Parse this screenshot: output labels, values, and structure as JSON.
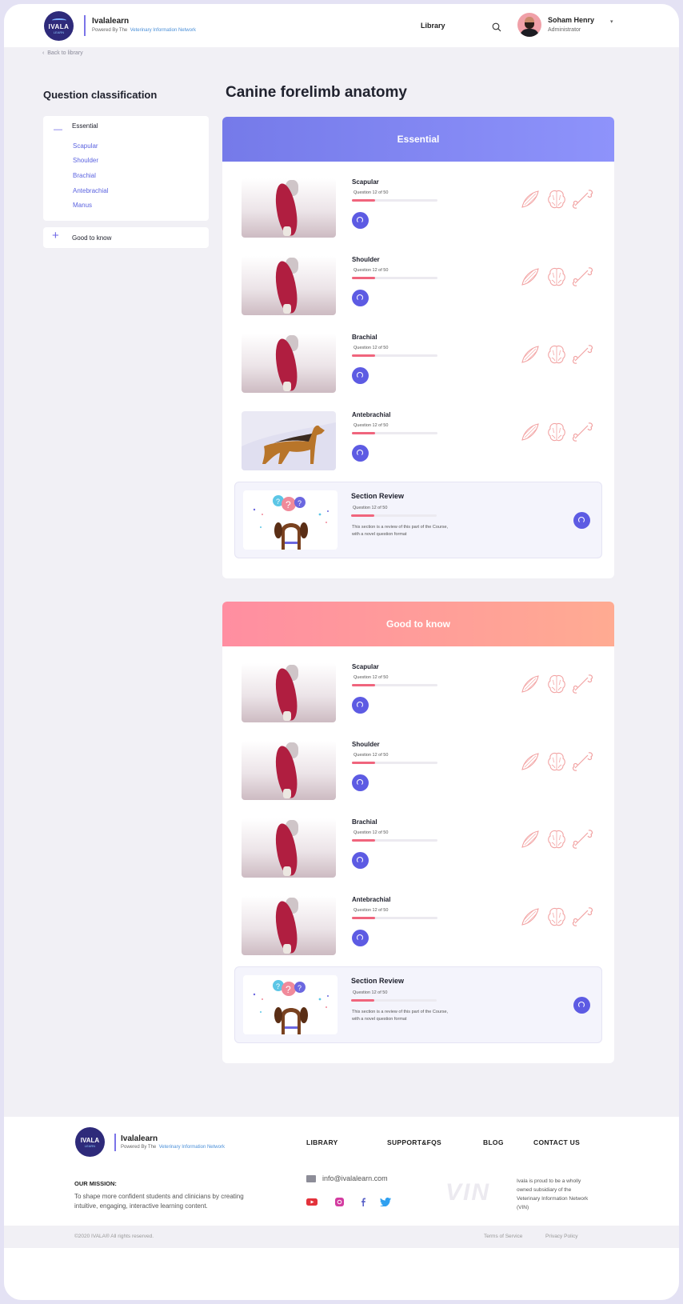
{
  "header": {
    "logo_text": "IVALA",
    "logo_sub": "LEARN",
    "brand_name": "Ivalalearn",
    "powered_by": "Powered By The",
    "powered_link": "Veterinary Information Network",
    "nav_library": "Library",
    "user_name": "Soham Henry",
    "user_role": "Administrator"
  },
  "back_link": "Back to library",
  "sidebar": {
    "title": "Question classification",
    "sections": [
      {
        "label": "Essential",
        "expanded": true,
        "items": [
          "Scapular",
          "Shoulder",
          "Brachial",
          "Antebrachial",
          "Manus"
        ]
      },
      {
        "label": "Good to know",
        "expanded": false
      }
    ]
  },
  "main": {
    "title": "Canine forelimb anatomy",
    "sections": [
      {
        "header": "Essential",
        "items": [
          {
            "title": "Scapular",
            "count": "Question 12 of 50",
            "progress": 0.27
          },
          {
            "title": "Shoulder",
            "count": "Question 12 of 50",
            "progress": 0.27
          },
          {
            "title": "Brachial",
            "count": "Question 12 of 50",
            "progress": 0.27
          },
          {
            "title": "Antebrachial",
            "count": "Question 12 of 50",
            "progress": 0.27
          }
        ],
        "review": {
          "title": "Section Review",
          "count": "Question 12 of 50",
          "progress": 0.27,
          "desc": "This section is a review of this part of the Course, with a novel question format"
        }
      },
      {
        "header": "Good to know",
        "items": [
          {
            "title": "Scapular",
            "count": "Question 12 of 50",
            "progress": 0.27
          },
          {
            "title": "Shoulder",
            "count": "Question 12 of 50",
            "progress": 0.27
          },
          {
            "title": "Brachial",
            "count": "Question 12 of 50",
            "progress": 0.27
          },
          {
            "title": "Antebrachial",
            "count": "Question 12 of 50",
            "progress": 0.27
          }
        ],
        "review": {
          "title": "Section Review",
          "count": "Question 12 of 50",
          "progress": 0.27,
          "desc": "This section is a review of this part of the Course, with a novel question format"
        }
      }
    ]
  },
  "footer": {
    "brand_name": "Ivalalearn",
    "powered_by": "Powered By The",
    "powered_link": "Veterinary Information Network",
    "nav": [
      "LIBRARY",
      "SUPPORT&FQS",
      "BLOG",
      "CONTACT US"
    ],
    "mission_heading": "OUR MISSION:",
    "mission_text": "To shape more confident students and clinicians by creating intuitive, engaging, interactive learning content.",
    "email": "info@ivalalearn.com",
    "vin_logo": "VIN",
    "vin_text": "Ivala is proud to be a wholly owned subsidiary of the Veterinary Information Network (VIN)",
    "copyright": "©2020 IVALA® All rights reserved.",
    "terms": "Terms of Service",
    "privacy": "Privacy Policy"
  },
  "colors": {
    "accent": "#5d5be3",
    "progress": "#f0657d",
    "essential_header": "#7f84f2",
    "good_header": "#ff9c9a",
    "icon_outline": "#f2a3a3"
  },
  "icons": [
    "muscle-icon",
    "brain-icon",
    "bone-icon",
    "search-icon",
    "mail-icon",
    "youtube-icon",
    "instagram-icon",
    "facebook-icon",
    "twitter-icon"
  ]
}
